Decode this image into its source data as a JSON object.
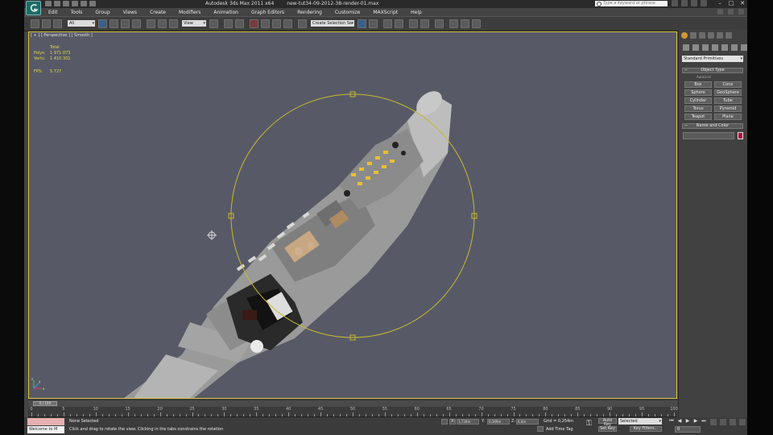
{
  "title": {
    "app": "Autodesk 3ds Max 2011 x64",
    "file": "new-tut34-09-2012-38-render-01.max",
    "search_placeholder": "Type a keyword or phrase"
  },
  "menu": [
    "Edit",
    "Tools",
    "Group",
    "Views",
    "Create",
    "Modifiers",
    "Animation",
    "Graph Editors",
    "Rendering",
    "Customize",
    "MAXScript",
    "Help"
  ],
  "toolbar": {
    "selection_filter": "All",
    "ref_coord": "View",
    "named_selection": "Create Selection Se"
  },
  "viewport": {
    "label": "[ + ] [ Perspective ] [ Smooth ]",
    "stats": {
      "total_label": "Total",
      "polys_label": "Polys:",
      "polys_value": "1 971 073",
      "verts_label": "Verts:",
      "verts_value": "1 410 301",
      "fps_label": "FPS:",
      "fps_value": "5.727"
    },
    "axis": {
      "x": "x",
      "y": "y",
      "z": "z"
    },
    "colors": {
      "background": "#575a66",
      "border": "#d8c23a",
      "gizmo": "#c8b830"
    }
  },
  "command_panel": {
    "category": "Standard Primitives",
    "object_type_title": "Object Type",
    "autogrid": "AutoGrid",
    "buttons": [
      "Box",
      "Cone",
      "Sphere",
      "GeoSphere",
      "Cylinder",
      "Tube",
      "Torus",
      "Pyramid",
      "Teapot",
      "Plane"
    ],
    "name_color_title": "Name and Color",
    "swatch_color": "#b0103a"
  },
  "timeline": {
    "thumb": "0 / 100",
    "ticks": [
      "0",
      "5",
      "10",
      "15",
      "20",
      "25",
      "30",
      "35",
      "40",
      "45",
      "50",
      "55",
      "60",
      "65",
      "70",
      "75",
      "80",
      "85",
      "90",
      "95",
      "100"
    ]
  },
  "status": {
    "listener": "Welcome to M",
    "selection": "None Selected",
    "prompt": "Click and drag to rotate the view.  Clicking in the tabs constrains the rotation",
    "x_label": "X:",
    "x_value": "1,734m",
    "y_label": "Y:",
    "y_value": "0,369m",
    "z_label": "Z:",
    "z_value": "0,0m",
    "grid": "Grid = 0,254m",
    "add_time_tag": "Add Time Tag",
    "auto_key": "Auto Key",
    "selected": "Selected",
    "set_key": "Set Key",
    "key_filters": "Key Filters...",
    "frame": "0"
  }
}
